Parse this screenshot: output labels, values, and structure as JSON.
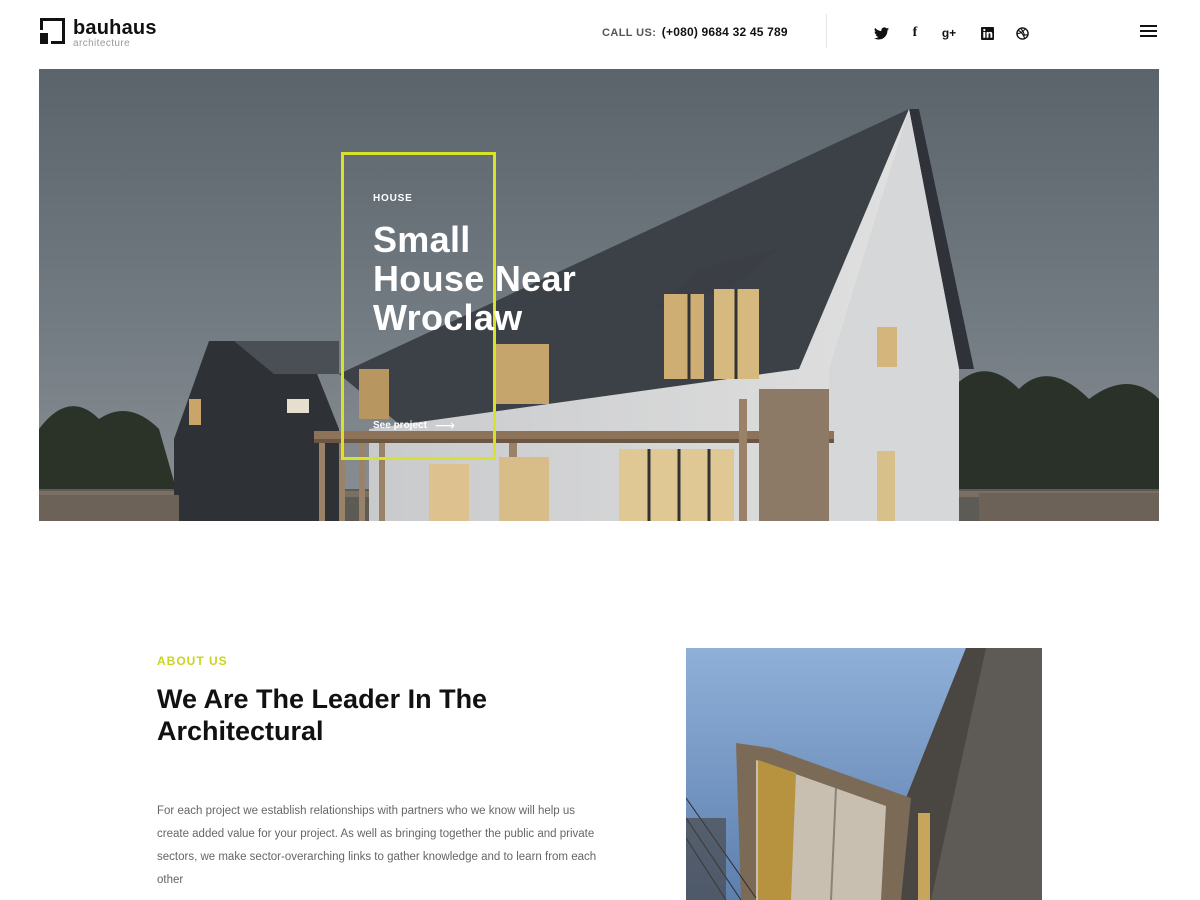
{
  "header": {
    "logo_name": "bauhaus",
    "logo_sub": "architecture",
    "call_label": "CALL US:",
    "call_number": "(+080) 9684 32 45 789",
    "social": [
      {
        "icon": "twitter-icon",
        "glyph": "🐦"
      },
      {
        "icon": "facebook-icon",
        "glyph": "f"
      },
      {
        "icon": "google-plus-icon",
        "glyph": "g+"
      },
      {
        "icon": "linkedin-icon",
        "glyph": "in"
      },
      {
        "icon": "dribbble-icon",
        "glyph": "◎"
      }
    ],
    "menu_icon": "hamburger-menu-icon"
  },
  "hero": {
    "category": "HOUSE",
    "title_lines": [
      "Small",
      "House Near",
      "Wroclaw"
    ],
    "link_label": "See project",
    "accent_color": "#d7e22a"
  },
  "about": {
    "label": "ABOUT US",
    "title": "We Are The Leader In The Architectural",
    "text": "For each project we establish relationships with partners who we know will help us create added value for your project. As well as bringing together the public and private sectors, we make sector-overarching links to gather knowledge and to learn from each other",
    "accent_color": "#c9d41e"
  }
}
